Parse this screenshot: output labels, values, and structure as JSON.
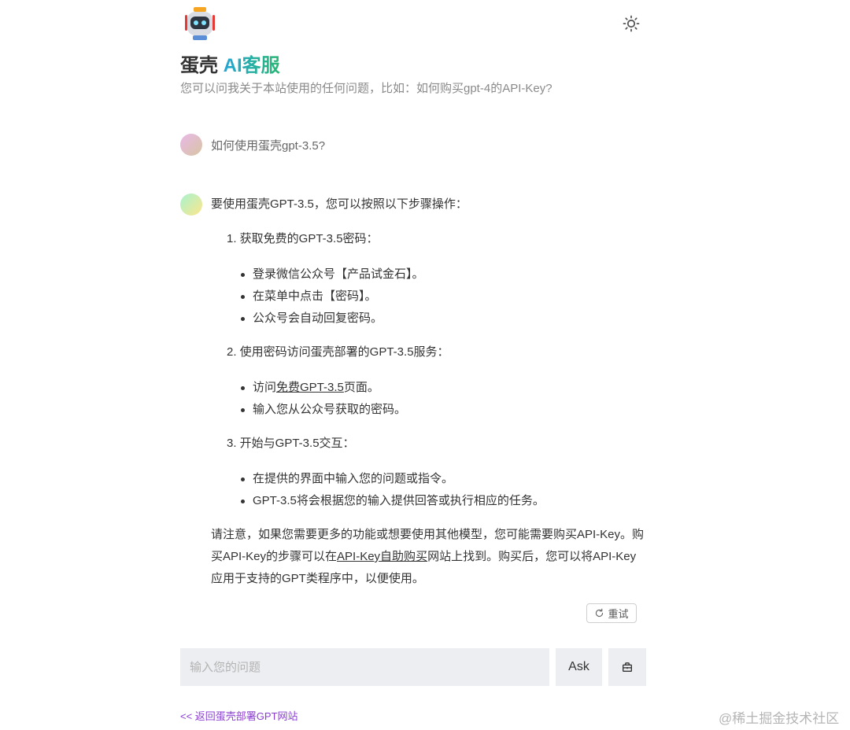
{
  "header": {
    "title_prefix": "蛋壳 ",
    "title_accent": "AI客服",
    "subtitle": "您可以问我关于本站使用的任何问题，比如：如何购买gpt-4的API-Key?"
  },
  "user_message": {
    "text": "如何使用蛋壳gpt-3.5?"
  },
  "bot_message": {
    "intro": "要使用蛋壳GPT-3.5，您可以按照以下步骤操作：",
    "steps": [
      {
        "title": "1. 获取免费的GPT-3.5密码：",
        "bullets": [
          "登录微信公众号【产品试金石】。",
          "在菜单中点击【密码】。",
          "公众号会自动回复密码。"
        ]
      },
      {
        "title": "2. 使用密码访问蛋壳部署的GPT-3.5服务：",
        "bullet1_prefix": "访问",
        "bullet1_link": "免费GPT-3.5",
        "bullet1_suffix": "页面。",
        "bullet2": "输入您从公众号获取的密码。"
      },
      {
        "title": "3. 开始与GPT-3.5交互：",
        "bullets": [
          "在提供的界面中输入您的问题或指令。",
          "GPT-3.5将会根据您的输入提供回答或执行相应的任务。"
        ]
      }
    ],
    "note_part1": "请注意，如果您需要更多的功能或想要使用其他模型，您可能需要购买API-Key。购买API-Key的步骤可以在",
    "note_link": "API-Key自助购买",
    "note_part2": "网站上找到。购买后，您可以将API-Key应用于支持的GPT类程序中，以便使用。"
  },
  "retry_label": "重试",
  "input": {
    "placeholder": "输入您的问题",
    "value": ""
  },
  "ask_label": "Ask",
  "back_link": "<< 返回蛋壳部署GPT网站",
  "watermark": "@稀土掘金技术社区",
  "colors": {
    "accent_gradient_start": "#23a6d5",
    "accent_gradient_end": "#2bb673",
    "link_purple": "#8b3fd1",
    "input_bg": "#eceef1"
  },
  "icons": {
    "logo": "robot-icon",
    "theme": "sun-icon",
    "retry": "refresh-icon",
    "clear": "clear-bag-icon"
  }
}
